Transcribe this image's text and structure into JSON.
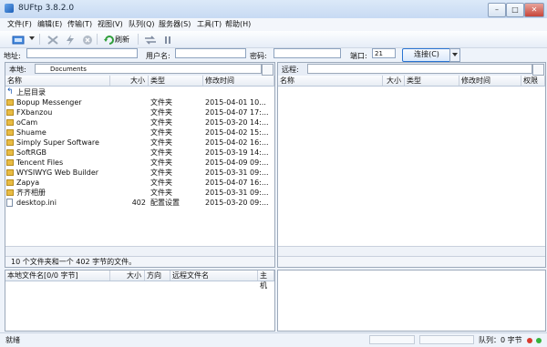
{
  "window": {
    "title": "8UFtp 3.8.2.0"
  },
  "titlebar_buttons": {
    "minimize": "–",
    "maximize": "□",
    "close": "✕"
  },
  "menu": [
    "文件(F)",
    "编辑(E)",
    "传输(T)",
    "视图(V)",
    "队列(Q)",
    "服务器(S)",
    "工具(T)",
    "帮助(H)"
  ],
  "toolbar": {
    "refresh_label": "刷新",
    "icons": [
      "site-manager-icon",
      "dropdown-arrow-icon",
      "disconnect-icon",
      "quick-connect-icon",
      "cancel-icon",
      "refresh-icon",
      "transfer-icon",
      "pause-icon"
    ]
  },
  "connect": {
    "address_label": "地址:",
    "user_label": "用户名:",
    "password_label": "密码:",
    "port_label": "端口:",
    "port_value": "21",
    "connect_label": "连接(C)"
  },
  "local": {
    "label": "本地:",
    "path": "Documents",
    "columns": [
      "名称",
      "大小",
      "类型",
      "修改时间"
    ],
    "rows": [
      {
        "name": "上层目录",
        "size": "",
        "type": "",
        "modified": "",
        "icon": "up"
      },
      {
        "name": "Bopup Messenger",
        "size": "",
        "type": "文件夹",
        "modified": "2015-04-01 10...",
        "icon": "folder"
      },
      {
        "name": "FXbanzou",
        "size": "",
        "type": "文件夹",
        "modified": "2015-04-07 17:...",
        "icon": "folder"
      },
      {
        "name": "oCam",
        "size": "",
        "type": "文件夹",
        "modified": "2015-03-20 14:...",
        "icon": "folder"
      },
      {
        "name": "Shuame",
        "size": "",
        "type": "文件夹",
        "modified": "2015-04-02 15:...",
        "icon": "folder"
      },
      {
        "name": "Simply Super Software",
        "size": "",
        "type": "文件夹",
        "modified": "2015-04-02 16:...",
        "icon": "folder"
      },
      {
        "name": "SoftRGB",
        "size": "",
        "type": "文件夹",
        "modified": "2015-03-19 14:...",
        "icon": "folder"
      },
      {
        "name": "Tencent Files",
        "size": "",
        "type": "文件夹",
        "modified": "2015-04-09 09:...",
        "icon": "folder"
      },
      {
        "name": "WYSIWYG Web Builder",
        "size": "",
        "type": "文件夹",
        "modified": "2015-03-31 09:...",
        "icon": "folder"
      },
      {
        "name": "Zapya",
        "size": "",
        "type": "文件夹",
        "modified": "2015-04-07 16:...",
        "icon": "folder"
      },
      {
        "name": "齐齐相册",
        "size": "",
        "type": "文件夹",
        "modified": "2015-03-31 09:...",
        "icon": "folder"
      },
      {
        "name": "desktop.ini",
        "size": "402",
        "type": "配置设置",
        "modified": "2015-03-20 09:...",
        "icon": "file"
      }
    ],
    "status": "10 个文件夹和一个 402 字节的文件。"
  },
  "remote": {
    "label": "远程:",
    "path": "",
    "columns": [
      "名称",
      "大小",
      "类型",
      "修改时间",
      "权限"
    ]
  },
  "queue": {
    "columns": [
      "本地文件名[0/0 字节]",
      "大小",
      "方向",
      "远程文件名",
      "主机"
    ]
  },
  "statusbar": {
    "ready": "就绪",
    "queue": "队列：0 字节"
  },
  "colors": {
    "accent": "#2b75d3",
    "folder": "#e8bc44",
    "led_red": "#d83a2e",
    "led_green": "#35b33a"
  }
}
